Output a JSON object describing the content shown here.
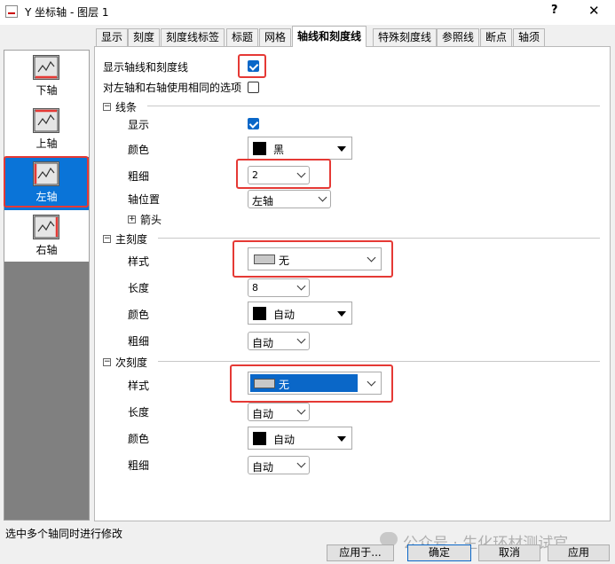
{
  "window": {
    "title": "Y 坐标轴 - 图层 1",
    "help": "?",
    "close": "✕"
  },
  "tabs": [
    "显示",
    "刻度",
    "刻度线标签",
    "标题",
    "网格",
    "轴线和刻度线",
    "特殊刻度线",
    "参照线",
    "断点",
    "轴须"
  ],
  "active_tab": "轴线和刻度线",
  "axes": [
    {
      "label": "下轴",
      "icon": "bottom-axis-icon"
    },
    {
      "label": "上轴",
      "icon": "top-axis-icon"
    },
    {
      "label": "左轴",
      "icon": "left-axis-icon",
      "selected": true
    },
    {
      "label": "右轴",
      "icon": "right-axis-icon"
    }
  ],
  "options": {
    "show_axis_ticks": {
      "label": "显示轴线和刻度线",
      "checked": true
    },
    "same_options": {
      "label": "对左轴和右轴使用相同的选项",
      "checked": false
    }
  },
  "line": {
    "header": "线条",
    "show_label": "显示",
    "show_checked": true,
    "color_label": "颜色",
    "color_value": "黑",
    "thickness_label": "粗细",
    "thickness_value": "2",
    "position_label": "轴位置",
    "position_value": "左轴",
    "arrow_label": "箭头"
  },
  "major": {
    "header": "主刻度",
    "style_label": "样式",
    "style_value": "无",
    "length_label": "长度",
    "length_value": "8",
    "color_label": "颜色",
    "color_value": "自动",
    "thickness_label": "粗细",
    "thickness_value": "自动"
  },
  "minor": {
    "header": "次刻度",
    "style_label": "样式",
    "style_value": "无",
    "length_label": "长度",
    "length_value": "自动",
    "color_label": "颜色",
    "color_value": "自动",
    "thickness_label": "粗细",
    "thickness_value": "自动"
  },
  "status": "选中多个轴同时进行修改",
  "buttons": {
    "apply_to": "应用于...",
    "ok": "确定",
    "cancel": "取消",
    "apply": "应用"
  },
  "watermark": "公众号 · 生化环材测试官",
  "colors": {
    "accent": "#0a74d8",
    "highlight": "#e53935"
  }
}
